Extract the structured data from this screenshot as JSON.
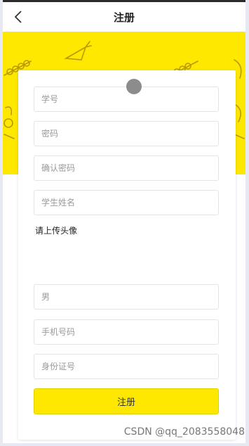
{
  "header": {
    "title": "注册",
    "back_icon": "chevron-left-icon"
  },
  "form": {
    "student_id_placeholder": "学号",
    "password_placeholder": "密码",
    "confirm_password_placeholder": "确认密码",
    "student_name_placeholder": "学生姓名",
    "upload_avatar_label": "请上传头像",
    "gender_placeholder": "男",
    "phone_placeholder": "手机号码",
    "id_card_placeholder": "身份证号",
    "submit_label": "注册"
  },
  "watermark": "CSDN @qq_2083558048",
  "colors": {
    "accent": "#ffe800",
    "card": "#ffffff",
    "text": "#222222"
  }
}
